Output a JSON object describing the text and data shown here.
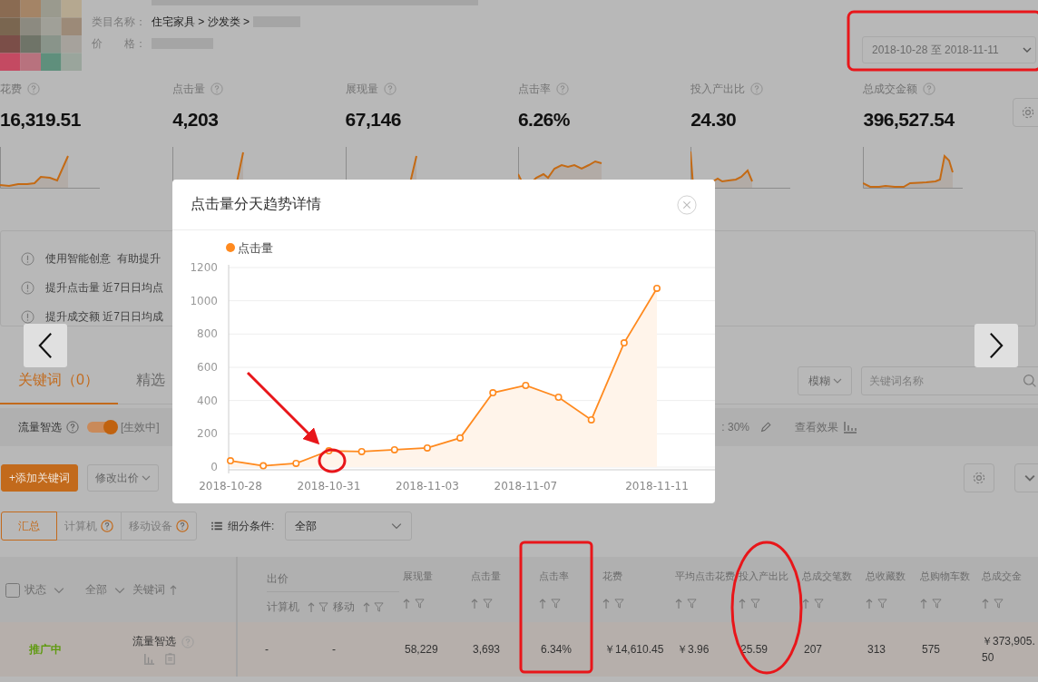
{
  "product": {
    "category_label": "类目名称：",
    "category_path": "住宅家具 > 沙发类 >",
    "price_label": "价　　格："
  },
  "date_range": "2018-10-28 至 2018-11-11",
  "metrics": [
    {
      "label": "花费",
      "value": "16,319.51"
    },
    {
      "label": "点击量",
      "value": "4,203"
    },
    {
      "label": "展现量",
      "value": "67,146"
    },
    {
      "label": "点击率",
      "value": "6.26%"
    },
    {
      "label": "投入产出比",
      "value": "24.30"
    },
    {
      "label": "总成交金额",
      "value": "396,527.54"
    }
  ],
  "tips": [
    {
      "text": "使用智能创意  有助提升"
    },
    {
      "text": "提升点击量 近7日日均点"
    },
    {
      "text": "提升成交额 近7日日均成"
    }
  ],
  "tabs": [
    {
      "label": "关键词（0）",
      "selected": true
    },
    {
      "label": "精选",
      "selected": false
    }
  ],
  "match_button": "模糊",
  "search": {
    "placeholder": "关键词名称"
  },
  "smart_bar": {
    "label": "流量智选",
    "on": true,
    "status": "[生效中]",
    "premium_fragment": ": 30%",
    "effect_link": "查看效果"
  },
  "actions": [
    {
      "label": "+添加关键词",
      "kind": "primary"
    },
    {
      "label": "修改出价",
      "kind": "dropdown"
    }
  ],
  "device_tabs": [
    {
      "label": "汇总",
      "selected": true,
      "help": false
    },
    {
      "label": "计算机",
      "selected": false,
      "help": true
    },
    {
      "label": "移动设备",
      "selected": false,
      "help": true
    }
  ],
  "segment": {
    "label": "细分条件:",
    "value": "全部"
  },
  "table": {
    "select_all_checked": false,
    "columns": [
      {
        "label": "状态",
        "kind": "dropdown"
      },
      {
        "label": "全部",
        "kind": "dropdown"
      },
      {
        "label": "关键词",
        "kind": "sort"
      },
      {
        "label": "出价",
        "kind": "group",
        "children": [
          {
            "label": "计算机"
          },
          {
            "label": "移动"
          }
        ]
      },
      {
        "label": "展现量",
        "kind": "metric"
      },
      {
        "label": "点击量",
        "kind": "metric"
      },
      {
        "label": "点击率",
        "kind": "metric"
      },
      {
        "label": "花费",
        "kind": "metric"
      },
      {
        "label": "平均点击花费",
        "kind": "metric"
      },
      {
        "label": "投入产出比",
        "kind": "metric"
      },
      {
        "label": "总成交笔数",
        "kind": "metric"
      },
      {
        "label": "总收藏数",
        "kind": "metric"
      },
      {
        "label": "总购物车数",
        "kind": "metric"
      },
      {
        "label": "总成交金",
        "kind": "metric"
      }
    ],
    "rows": [
      {
        "status": "推广中",
        "keyword": "流量智选",
        "values": [
          "-",
          "-",
          "58,229",
          "3,693",
          "6.34%",
          "￥14,610.45",
          "￥3.96",
          "25.59",
          "207",
          "313",
          "575",
          "￥373,905.50"
        ]
      }
    ]
  },
  "modal": {
    "title": "点击量分天趋势详情",
    "chart_data": {
      "type": "area",
      "grid": true,
      "categories": [
        "2018-10-28",
        null,
        null,
        "2018-10-31",
        null,
        null,
        "2018-11-03",
        null,
        null,
        "2018-11-07",
        null,
        null,
        null,
        "2018-11-11"
      ],
      "series": [
        {
          "name": "点击量",
          "color": "#ff8a1f",
          "values": [
            38,
            8,
            22,
            98,
            93,
            104,
            115,
            175,
            447,
            491,
            420,
            284,
            747,
            1075
          ]
        }
      ],
      "ylim": [
        0,
        1200
      ],
      "yticks": [
        0,
        200,
        400,
        600,
        800,
        1000,
        1200
      ]
    }
  }
}
